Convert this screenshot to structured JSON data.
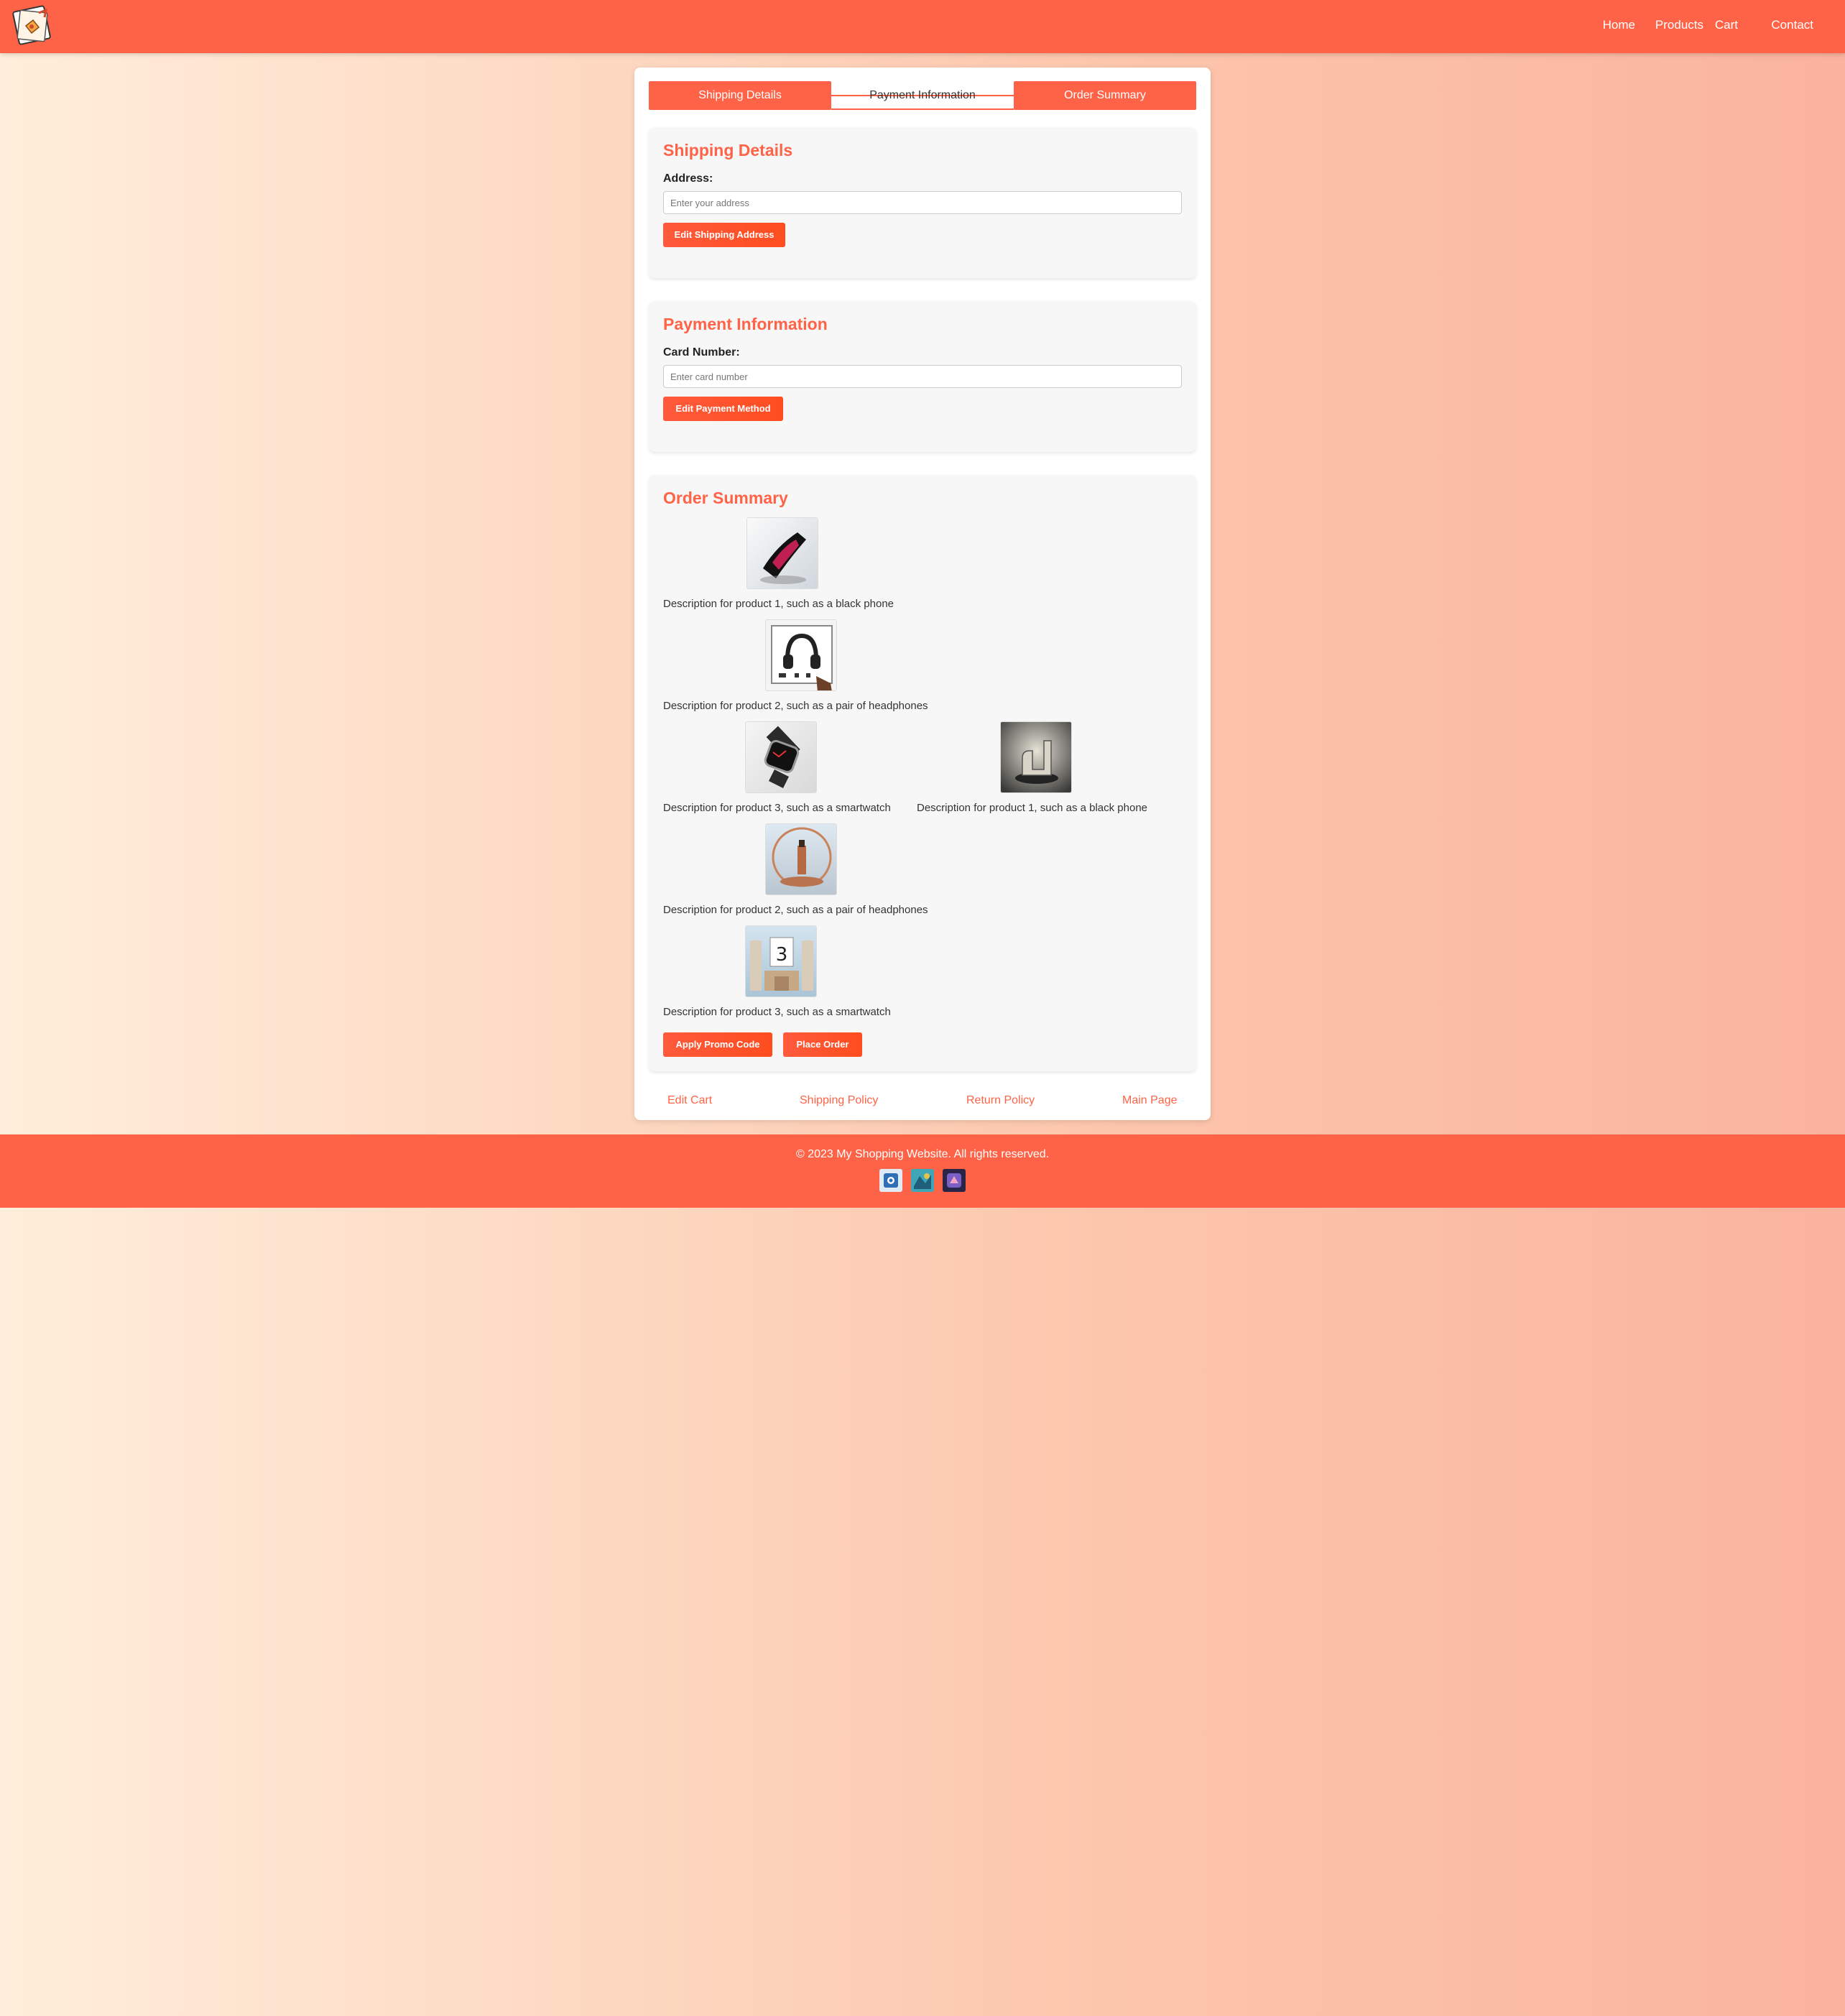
{
  "header": {
    "logo_icon": "shopping-logo-icon",
    "nav": [
      {
        "label": "Home"
      },
      {
        "label": "Products"
      },
      {
        "label": "Cart"
      },
      {
        "label": "Contact"
      }
    ]
  },
  "steps": [
    {
      "label": "Shipping Details",
      "active": true
    },
    {
      "label": "Payment Information",
      "active": false
    },
    {
      "label": "Order Summary",
      "active": true
    }
  ],
  "shipping": {
    "title": "Shipping Details",
    "label": "Address:",
    "placeholder": "Enter your address",
    "value": "",
    "button": "Edit Shipping Address"
  },
  "payment": {
    "title": "Payment Information",
    "label": "Card Number:",
    "placeholder": "Enter card number",
    "value": "",
    "button": "Edit Payment Method"
  },
  "order": {
    "title": "Order Summary",
    "products": [
      {
        "description": "Description for product 1, such as a black phone",
        "image": "black-phone-image"
      },
      {
        "description": "Description for product 2, such as a pair of headphones",
        "image": "headphones-image"
      },
      {
        "description": "Description for product 3, such as a smartwatch",
        "image": "smartwatch-image"
      },
      {
        "description": "Description for product 1, such as a black phone",
        "image": "abstract-sculpture-image"
      },
      {
        "description": "Description for product 2, such as a pair of headphones",
        "image": "lipstick-pedestal-image"
      },
      {
        "description": "Description for product 3, such as a smartwatch",
        "image": "number-three-podium-image"
      }
    ],
    "promo_button": "Apply Promo Code",
    "place_button": "Place Order"
  },
  "links": [
    {
      "label": "Edit Cart"
    },
    {
      "label": "Shipping Policy"
    },
    {
      "label": "Return Policy"
    },
    {
      "label": "Main Page"
    }
  ],
  "footer": {
    "copyright": "© 2023 My Shopping Website. All rights reserved.",
    "social_icons": [
      "social-icon-1",
      "social-icon-2",
      "social-icon-3"
    ]
  },
  "colors": {
    "accent": "#ff6347",
    "button": "#ff4d1f",
    "section_bg": "#f7f7f7"
  }
}
